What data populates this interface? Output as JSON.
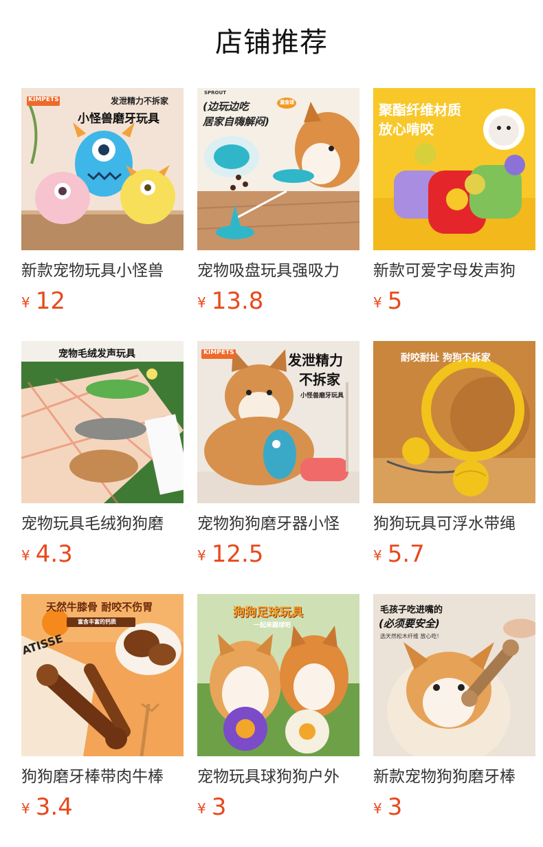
{
  "page": {
    "title": "店铺推荐",
    "currency_symbol": "¥"
  },
  "products": [
    {
      "name": "新款宠物玩具小怪兽",
      "price": "12",
      "image": {
        "brand": "KIMPETS",
        "caption_top": "发泄精力不拆家",
        "caption_main": "小怪兽磨牙玩具",
        "colors": {
          "bg": "#f1d9c8",
          "accent": "#3fb6e8"
        }
      }
    },
    {
      "name": "宠物吸盘玩具强吸力",
      "price": "13.8",
      "image": {
        "brand": "SPROUT",
        "caption_main": "(边玩边吃",
        "caption_sub": "居家自嗨解闷)",
        "badge": "漏食球",
        "colors": {
          "bg": "#d8b08a",
          "accent": "#2fb7c9"
        }
      }
    },
    {
      "name": "新款可爱字母发声狗",
      "price": "5",
      "image": {
        "caption_main": "聚酯纤维材质",
        "caption_sub": "放心啃咬",
        "colors": {
          "bg": "#f7c928",
          "accent": "#e4262b"
        }
      }
    },
    {
      "name": "宠物玩具毛绒狗狗磨",
      "price": "4.3",
      "image": {
        "caption_main": "宠物毛绒发声玩具",
        "colors": {
          "bg": "#3f7a35",
          "accent": "#f08a4b"
        }
      }
    },
    {
      "name": "宠物狗狗磨牙器小怪",
      "price": "12.5",
      "image": {
        "brand": "KIMPETS",
        "caption_main": "发泄精力",
        "caption_sub": "不拆家",
        "caption_small": "小怪兽磨牙玩具",
        "colors": {
          "bg": "#efe7df",
          "accent": "#3aa9c8"
        }
      }
    },
    {
      "name": "狗狗玩具可浮水带绳",
      "price": "5.7",
      "image": {
        "caption_main": "耐咬耐扯 狗狗不拆家",
        "colors": {
          "bg": "#c7863a",
          "accent": "#f2c31b"
        }
      }
    },
    {
      "name": "狗狗磨牙棒带肉牛棒",
      "price": "3.4",
      "image": {
        "caption_main": "天然牛膝骨 耐咬不伤胃",
        "caption_sub": "富含丰富的钙质",
        "caption_small": "ATISSE",
        "colors": {
          "bg": "#f0a058",
          "accent": "#7a3d16"
        }
      }
    },
    {
      "name": "宠物玩具球狗狗户外",
      "price": "3",
      "image": {
        "caption_main": "狗狗足球玩具",
        "caption_sub": "一起来踢球吧",
        "colors": {
          "bg": "#8fb36a",
          "accent": "#f2a62a"
        }
      }
    },
    {
      "name": "新款宠物狗狗磨牙棒",
      "price": "3",
      "image": {
        "caption_main": "毛孩子吃进嘴的",
        "caption_sub": "(必须要安全)",
        "caption_small": "选天然松木纤维 放心吃!",
        "colors": {
          "bg": "#e9dfd3",
          "accent": "#a77a4e"
        }
      }
    }
  ]
}
